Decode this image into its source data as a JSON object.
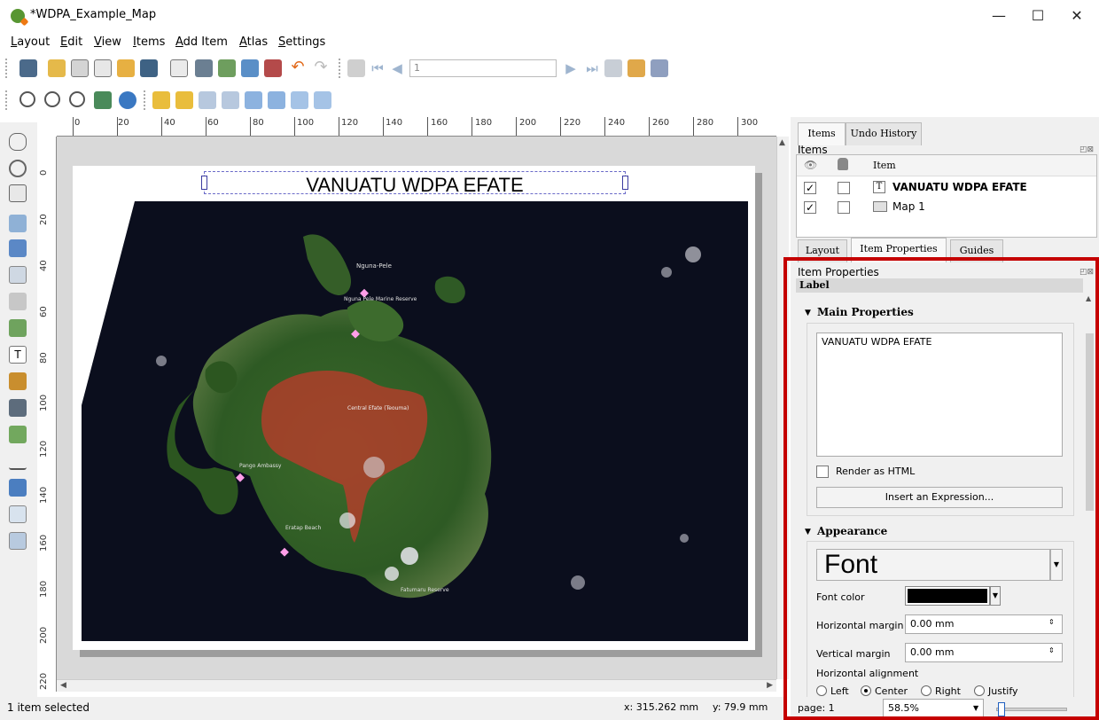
{
  "window": {
    "title": "*WDPA_Example_Map",
    "minimize": "—",
    "maximize": "☐",
    "close": "✕"
  },
  "menu": [
    "Layout",
    "Edit",
    "View",
    "Items",
    "Add Item",
    "Atlas",
    "Settings"
  ],
  "toolbar": {
    "page_field_value": "1"
  },
  "ruler": {
    "top_labels": [
      "0",
      "20",
      "40",
      "60",
      "80",
      "100",
      "120",
      "140",
      "160",
      "180",
      "200",
      "220",
      "240",
      "260",
      "280",
      "300"
    ],
    "left_labels": [
      "0",
      "20",
      "40",
      "60",
      "80",
      "100",
      "120",
      "140",
      "160",
      "180",
      "200",
      "220"
    ]
  },
  "layout": {
    "label_text": "VANUATU WDPA EFATE"
  },
  "map_labels": {
    "nguna": "Nguna-Pele",
    "marine": "Nguna Pele Marine Reserve",
    "central": "Central Efate (Teouma)",
    "ambassy": "Pango Ambassy",
    "south": "Eratap Beach",
    "south2": "Fatumaru Reserve"
  },
  "right_panel": {
    "tabs_top": [
      "Items",
      "Undo History"
    ],
    "items_title": "Items",
    "items_header_item": "Item",
    "items": [
      {
        "icon": "T",
        "name": "VANUATU WDPA EFATE",
        "visible": "✓"
      },
      {
        "icon": "",
        "name": "Map 1",
        "visible": "✓"
      }
    ],
    "tabs_bottom": [
      "Layout",
      "Item Properties",
      "Guides"
    ],
    "props_title": "Item Properties",
    "props_subtitle": "Label",
    "main_properties": "Main Properties",
    "text_value": "VANUATU WDPA EFATE",
    "render_html": "Render as HTML",
    "insert_expression": "Insert an Expression...",
    "appearance": "Appearance",
    "font_button": "Font",
    "font_color_label": "Font color",
    "h_margin_label": "Horizontal margin",
    "h_margin_value": "0.00 mm",
    "v_margin_label": "Vertical margin",
    "v_margin_value": "0.00 mm",
    "h_align_label": "Horizontal alignment",
    "align_options": [
      "Left",
      "Center",
      "Right",
      "Justify"
    ],
    "page_label": "page: 1",
    "zoom_value": "58.5%"
  },
  "status": {
    "selected": "1 item selected",
    "x_coord": "x: 315.262 mm",
    "y_coord": "y: 79.9 mm"
  },
  "colors": {
    "highlight_box": "#c50000",
    "protected_area": "#c0392b"
  }
}
